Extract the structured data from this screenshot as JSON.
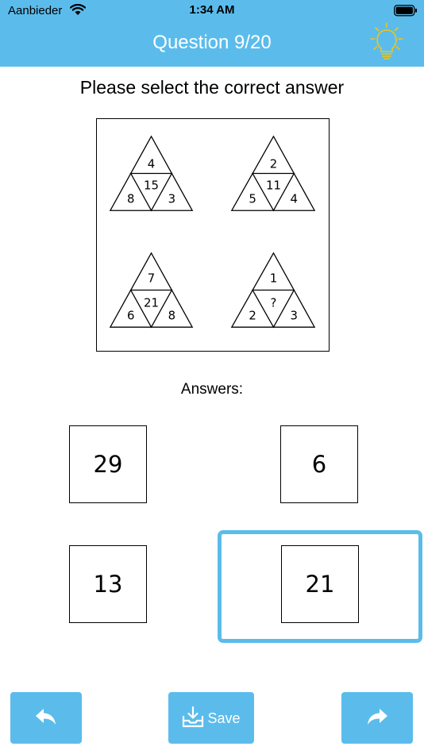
{
  "status_bar": {
    "carrier": "Aanbieder",
    "time": "1:34 AM"
  },
  "header": {
    "title": "Question 9/20",
    "accent_color": "#5bbcec",
    "hint_icon_color": "#f0c419"
  },
  "prompt": "Please select the correct answer",
  "puzzle": {
    "triangles": [
      {
        "top": "4",
        "center": "15",
        "left": "8",
        "right": "3"
      },
      {
        "top": "2",
        "center": "11",
        "left": "5",
        "right": "4"
      },
      {
        "top": "7",
        "center": "21",
        "left": "6",
        "right": "8"
      },
      {
        "top": "1",
        "center": "?",
        "left": "2",
        "right": "3"
      }
    ]
  },
  "answers_label": "Answers:",
  "answers": [
    {
      "value": "29"
    },
    {
      "value": "6"
    },
    {
      "value": "13"
    },
    {
      "value": "21"
    }
  ],
  "selected_answer": "21",
  "toolbar": {
    "back_icon": "reply-arrow-icon",
    "save_label": "Save",
    "save_icon": "download-tray-icon",
    "next_icon": "forward-arrow-icon"
  }
}
